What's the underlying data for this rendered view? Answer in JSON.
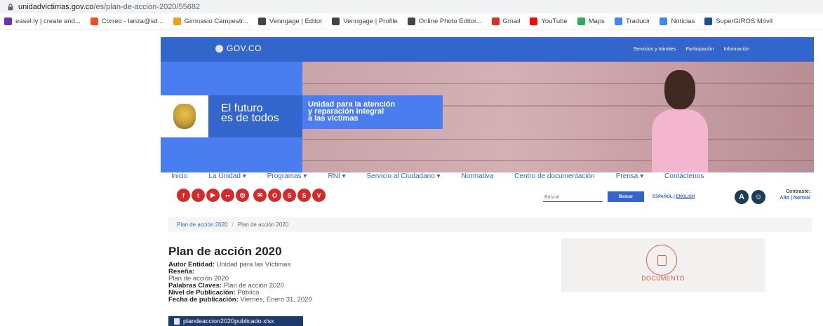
{
  "browser": {
    "url_host": "unidadvictimas.gov.co",
    "url_path": "/es/plan-de-accion-2020/55682"
  },
  "bookmarks": [
    {
      "label": "easel.ly | create and...",
      "color": "#6e2fb5"
    },
    {
      "label": "Correo - lariza@sd...",
      "color": "#f25022"
    },
    {
      "label": "Gimnasio Campestr...",
      "color": "#e8a317"
    },
    {
      "label": "Venngage | Editor",
      "color": "#444444"
    },
    {
      "label": "Venngage | Profile",
      "color": "#444444"
    },
    {
      "label": "Online Photo Editor...",
      "color": "#444444"
    },
    {
      "label": "Gmail",
      "color": "#d93025"
    },
    {
      "label": "YouTube",
      "color": "#ff0000"
    },
    {
      "label": "Maps",
      "color": "#34a853"
    },
    {
      "label": "Traducir",
      "color": "#4285f4"
    },
    {
      "label": "Noticias",
      "color": "#4285f4"
    },
    {
      "label": "SuperGIROS Móvil",
      "color": "#1a4fa0"
    }
  ],
  "govbar": {
    "logo": "GOV.CO",
    "links": [
      "Servicios y trámites",
      "Participación",
      "Información"
    ]
  },
  "hero": {
    "futuro_line1": "El futuro",
    "futuro_line2": "es de todos",
    "unidad_line1": "Unidad para la atención",
    "unidad_line2": "y reparación integral",
    "unidad_line3": "a las víctimas"
  },
  "nav": {
    "items": [
      "Inicio",
      "La Unidad ▾",
      "Programas ▾",
      "RNI ▾",
      "Servicio al Ciudadano ▾",
      "Normativa",
      "Centro de documentación",
      "Prensa ▾",
      "Contáctenos"
    ]
  },
  "socials": [
    {
      "glyph": "f",
      "color": "#d42a2a"
    },
    {
      "glyph": "t",
      "color": "#d42a2a"
    },
    {
      "glyph": "▶",
      "color": "#d42a2a"
    },
    {
      "glyph": "••",
      "color": "#d42a2a"
    },
    {
      "glyph": "◎",
      "color": "#d42a2a"
    },
    {
      "glyph": "✉",
      "color": "#d42a2a"
    },
    {
      "glyph": "O",
      "color": "#d42a2a"
    },
    {
      "glyph": "S",
      "color": "#d42a2a"
    },
    {
      "glyph": "S",
      "color": "#d42a2a"
    },
    {
      "glyph": "V",
      "color": "#d42a2a"
    }
  ],
  "search": {
    "placeholder": "Buscar",
    "button": "Buscar"
  },
  "langs": {
    "es": "ESPAÑOL",
    "sep": "|",
    "en": "ENGLISH"
  },
  "contrast": {
    "label": "Contraste:",
    "options": "Alto  | Normal"
  },
  "breadcrumb": {
    "items": [
      "Plan de acción 2020",
      "Plan de acción 2020"
    ],
    "separator": "/"
  },
  "document": {
    "title": "Plan de acción 2020",
    "autor_label": "Autor Entidad:",
    "autor_value": "Unidad para las Víctimas",
    "resena_label": "Reseña:",
    "resena_value": "Plan de acción 2020",
    "palabras_label": "Palabras Claves:",
    "palabras_value": "Plan de acción 2020",
    "nivel_label": "Nivel de Publicación:",
    "nivel_value": "Público",
    "fecha_label": "Fecha de publicación:",
    "fecha_value": "Viernes, Enero 31, 2020",
    "file_name": "plandeaccion2020publicado.xlsx",
    "doc_label": "DOCUMENTO"
  }
}
